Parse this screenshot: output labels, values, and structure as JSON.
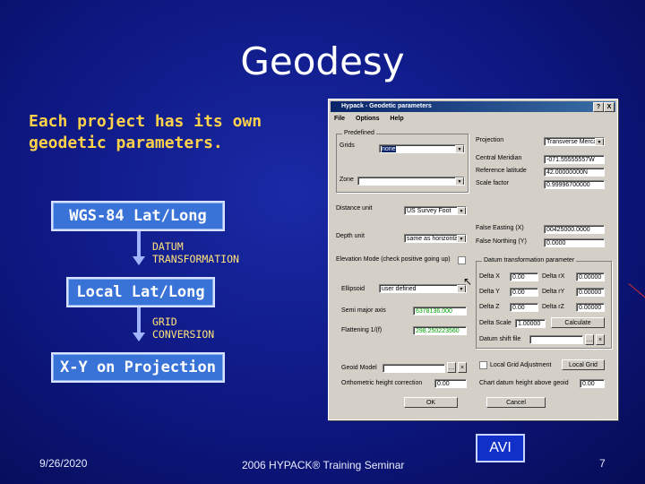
{
  "slide": {
    "title": "Geodesy",
    "intro": "Each project has its own geodetic parameters.",
    "steps": [
      {
        "box": "WGS-84 Lat/Long"
      },
      {
        "arrow_label_1": "DATUM",
        "arrow_label_2": "TRANSFORMATION"
      },
      {
        "box": "Local Lat/Long"
      },
      {
        "arrow_label_1": "GRID",
        "arrow_label_2": "CONVERSION"
      },
      {
        "box": "X-Y on Projection"
      }
    ],
    "avi_label": "AVI",
    "footer": {
      "date": "9/26/2020",
      "seminar": "2006 HYPACK® Training Seminar",
      "page": "7"
    }
  },
  "dialog": {
    "title": "Hypack - Geodetic parameters",
    "title_buttons": [
      "?",
      "X"
    ],
    "menu": [
      "File",
      "Options",
      "Help"
    ],
    "grid_group_label": "Predefined",
    "grids_label": "Grids",
    "grids_value": "none",
    "zone_label": "Zone",
    "zone_value": "",
    "distance_unit_label": "Distance unit",
    "distance_unit_value": "US Survey Foot",
    "depth_unit_label": "Depth unit",
    "depth_unit_value": "same as horizontal",
    "projection_label": "Projection",
    "projection_value": "Transverse Mercator",
    "central_meridian_label": "Central Meridian",
    "central_meridian_value": "-071.55555557W",
    "reference_latitude_label": "Reference latitude",
    "reference_latitude_value": "42.00000000N",
    "scale_factor_label": "Scale factor",
    "scale_factor_value": "0.99996700000",
    "false_easting_label": "False Easting (X)",
    "false_easting_value": "00425000.0000",
    "false_northing_label": "False Northing (Y)",
    "false_northing_value": "0.0000",
    "elevation_mode_label": "Elevation Mode (check positive going up)",
    "ellipsoid_label": "Ellipsoid",
    "ellipsoid_value": "user defined",
    "semimajor_label": "Semi major axis",
    "semimajor_value": "6378136.000",
    "flattening_label": "Flattening 1/(f)",
    "flattening_value": "298.250223560",
    "datum_group_label": "Datum transformation parameter",
    "delta_x_label": "Delta X",
    "delta_x_value": "0.00",
    "delta_y_label": "Delta Y",
    "delta_y_value": "0.00",
    "delta_z_label": "Delta Z",
    "delta_z_value": "0.00",
    "rot_x_label": "Delta rX",
    "rot_x_value": "0.00000",
    "rot_y_label": "Delta rY",
    "rot_y_value": "0.00000",
    "rot_z_label": "Delta rZ",
    "rot_z_value": "0.00000",
    "delta_scale_label": "Delta Scale",
    "delta_scale_value": "1.00000",
    "calculate_label": "Calculate",
    "datum_shift_label": "Datum shift file",
    "datum_shift_value": "",
    "geoid_model_label": "Geoid Model",
    "geoid_model_value": "",
    "local_grid_label": "Local Grid Adjustment",
    "local_grid_button": "Local Grid",
    "orthometric_label": "Orthometric height correction",
    "orthometric_value": "0.00",
    "chart_datum_label": "Chart datum height above geoid",
    "chart_datum_value": "0.00",
    "ok_label": "OK",
    "cancel_label": "Cancel"
  }
}
